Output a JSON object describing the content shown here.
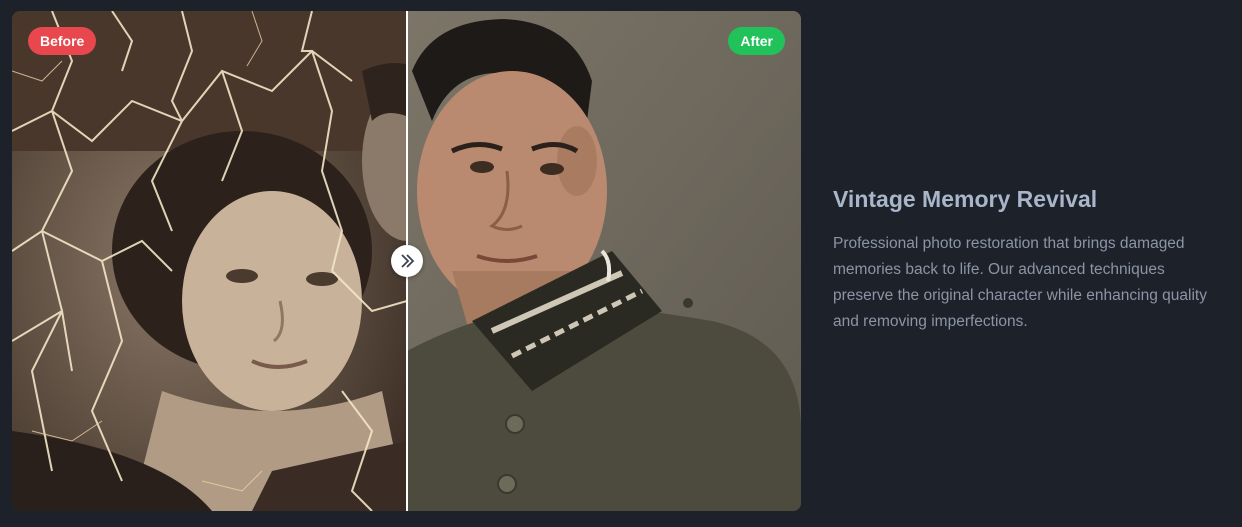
{
  "comparison": {
    "before_label": "Before",
    "after_label": "After",
    "slider_position_percent": 50,
    "before_image": "damaged sepia vintage portrait",
    "after_image": "restored colorized portrait",
    "handle_icon": "chevrons-left-right-icon"
  },
  "feature": {
    "title": "Vintage Memory Revival",
    "description": "Professional photo restoration that brings damaged memories back to life. Our advanced techniques preserve the original character while enhancing quality and removing imperfections."
  },
  "colors": {
    "background": "#1d212a",
    "before_badge": "#e7474d",
    "after_badge": "#22c25a",
    "title": "#a9b6c9",
    "body_text": "#8c95a4"
  }
}
